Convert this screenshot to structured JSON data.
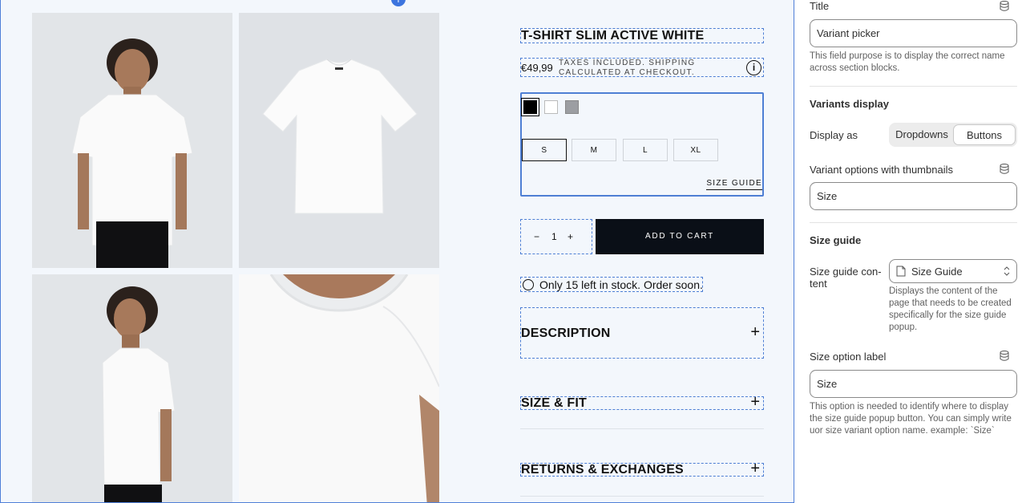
{
  "product": {
    "title": "T-SHIRT SLIM ACTIVE WHITE",
    "price": "€49,99",
    "tax_note": "TAXES INCLUDED. SHIPPING CALCULATED AT CHECKOUT.",
    "info_glyph": "i",
    "swatches": [
      {
        "name": "black",
        "color": "#000000"
      },
      {
        "name": "white",
        "color": "#ffffff"
      },
      {
        "name": "grey",
        "color": "#9c9ea2"
      }
    ],
    "sizes": [
      "S",
      "M",
      "L",
      "XL"
    ],
    "selected_size": "S",
    "size_guide_link": "SIZE GUIDE",
    "quantity": "1",
    "qty_minus": "−",
    "qty_plus": "+",
    "add_to_cart": "ADD TO CART",
    "stock_message": "Only 15 left in stock. Order soon.",
    "accordions": [
      "DESCRIPTION",
      "SIZE & FIT",
      "RETURNS & EXCHANGES"
    ],
    "accordion_plus": "+"
  },
  "panel": {
    "title_label": "Title",
    "title_value": "Variant picker",
    "title_help": "This field purpose is to display the correct name across section blocks.",
    "variants_display_heading": "Variants display",
    "display_as_label": "Display as",
    "display_as_options": [
      "Dropdowns",
      "Buttons"
    ],
    "display_as_selected": "Buttons",
    "thumbs_label": "Variant options with thumbnails",
    "thumbs_value": "Size",
    "size_guide_heading": "Size guide",
    "size_guide_content_label": "Size guide con-tent",
    "size_guide_content_value": "Size Guide",
    "size_guide_content_help": "Displays the content of the page that needs to be created specifically for the size guide popup.",
    "size_option_label": "Size option label",
    "size_option_value": "Size",
    "size_option_help": "This option is needed to identify where to display the size guide popup button. You can simply write uor size variant option name. example: `Size`"
  },
  "colors": {
    "accent": "#4e7fd4",
    "button_dark": "#0a0f17"
  }
}
